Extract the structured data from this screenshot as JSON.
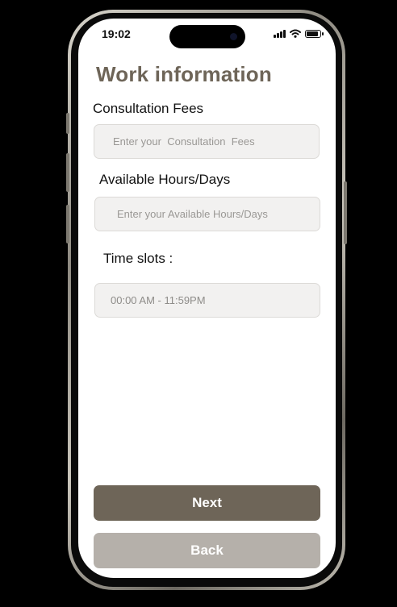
{
  "status_bar": {
    "time": "19:02"
  },
  "page": {
    "title": "Work information"
  },
  "fields": {
    "consultation_fees": {
      "label": "Consultation Fees",
      "placeholder": "Enter your  Consultation  Fees"
    },
    "available_hours": {
      "label": "Available Hours/Days",
      "placeholder": "Enter your Available Hours/Days"
    },
    "time_slots": {
      "label": "Time slots :",
      "value": "00:00 AM - 11:59PM"
    }
  },
  "buttons": {
    "next": "Next",
    "back": "Back"
  },
  "colors": {
    "title": "#6e6558",
    "primary_button": "#6e6558",
    "secondary_button": "#b5b0aa",
    "field_background": "#f2f1f0",
    "device_background": "#000000"
  },
  "icons": [
    "signal-icon",
    "wifi-icon",
    "battery-icon",
    "front-camera-icon"
  ]
}
